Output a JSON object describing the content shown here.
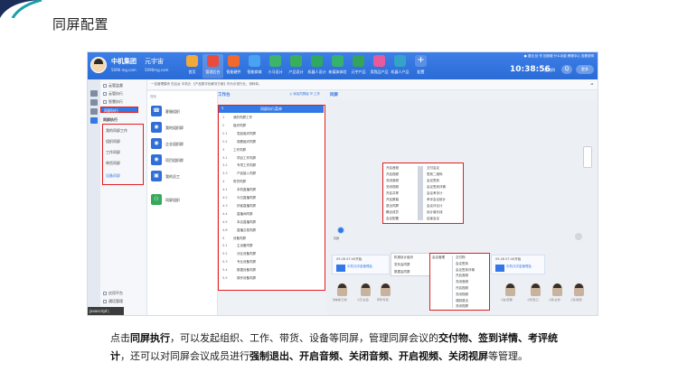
{
  "slide": {
    "title": "同屏配置"
  },
  "colors": {
    "corner_teal": "#1a9ea8",
    "corner_navy": "#1b2e5a",
    "topbar": "#2a6bd6",
    "accent": "#3478e5",
    "highlight_red": "#e02020"
  },
  "app": {
    "org_name": "中机集团",
    "org_sub": "5096 mg.com",
    "mode_name": "元宇宙",
    "mode_sub": "5096mg.com",
    "apps": [
      {
        "label": "首页",
        "color": "#f2a93b",
        "icon": "home-icon"
      },
      {
        "label": "管理后台",
        "color": "#e94b3c",
        "icon": "admin-icon"
      },
      {
        "label": "智能硬件",
        "color": "#f06a2e",
        "icon": "hardware-icon"
      },
      {
        "label": "智能商城",
        "color": "#4aa3f0",
        "icon": "shop-icon"
      },
      {
        "label": "小马设计",
        "color": "#3db36b",
        "icon": "design-icon"
      },
      {
        "label": "产品设计",
        "color": "#3aaf5b",
        "icon": "product-icon"
      },
      {
        "label": "机器人设计",
        "color": "#2fa862",
        "icon": "robot-icon"
      },
      {
        "label": "新媒体体验",
        "color": "#35b26f",
        "icon": "media-icon"
      },
      {
        "label": "元宇产品",
        "color": "#34a35b",
        "icon": "meta-icon"
      },
      {
        "label": "用我品产品",
        "color": "#e85a9b",
        "icon": "brand-icon"
      },
      {
        "label": "机器人产品",
        "color": "#33a3c8",
        "icon": "robot-product-icon"
      },
      {
        "label": "配置",
        "color": "#5a8fe8",
        "icon": "plus-icon"
      }
    ],
    "top_links": "● 退出   处 作   回到服   什么功能   教程中心   查看说明",
    "clock": "10:38:56",
    "clock_date": "星期四",
    "more_label": "更多",
    "search_glyph": "Q"
  },
  "nav": {
    "items_top": [
      {
        "label": "云管监督"
      },
      {
        "label": "云管执行"
      },
      {
        "label": "智慧执行"
      },
      {
        "label": "同屏执行"
      }
    ],
    "section_label": "同屏执行",
    "sub_items": [
      {
        "label": "我的同屏工作"
      },
      {
        "label": "组织同屏"
      },
      {
        "label": "工作同屏"
      },
      {
        "label": "带货同屏"
      },
      {
        "label": "设备同屏"
      }
    ],
    "items_bottom": [
      {
        "label": "应用平台"
      },
      {
        "label": "通话管理"
      },
      {
        "label": "资源管理"
      }
    ]
  },
  "subbar": {
    "path": "一站管理模块 在后台 中机元 【产品数字化解决方案】作为引领行业，请转体。",
    "back": "◄"
  },
  "contacts": {
    "search": "搜索",
    "items": [
      {
        "name": "客服组织",
        "glyph": "☎"
      },
      {
        "name": "我的组织群",
        "glyph": "◉"
      },
      {
        "name": "企业组织群",
        "glyph": "◉"
      },
      {
        "name": "项目组织群",
        "glyph": "◉"
      },
      {
        "name": "我的员工",
        "glyph": "▣"
      },
      {
        "name": "同屏组织",
        "glyph": "⚇"
      }
    ]
  },
  "workspace": {
    "label": "工作台",
    "links": "◎ 添加同屏组   ☰ 工作",
    "screen_label": "同屏"
  },
  "tree": {
    "header": "同屏执行菜单",
    "rows": [
      {
        "no": "1",
        "label": "我的同屏工作"
      },
      {
        "no": "2",
        "label": "组织同屏"
      },
      {
        "no": "2.1",
        "label": "发起组织同屏"
      },
      {
        "no": "2.2",
        "label": "观看组织同屏"
      },
      {
        "no": "3",
        "label": "工作同屏"
      },
      {
        "no": "3.1",
        "label": "项目工作同屏"
      },
      {
        "no": "3.2",
        "label": "专项工作同屏"
      },
      {
        "no": "3.3",
        "label": "产品接入同屏"
      },
      {
        "no": "4",
        "label": "带货同屏"
      },
      {
        "no": "4.1",
        "label": "本机直播同屏"
      },
      {
        "no": "4.2",
        "label": "今日直播同屏"
      },
      {
        "no": "4.3",
        "label": "好客直播同屏"
      },
      {
        "no": "4.4",
        "label": "直播间同屏"
      },
      {
        "no": "4.5",
        "label": "本店直播同屏"
      },
      {
        "no": "4.6",
        "label": "直播交易同屏"
      },
      {
        "no": "5",
        "label": "设备同屏"
      },
      {
        "no": "5.1",
        "label": "主设备同屏"
      },
      {
        "no": "5.2",
        "label": "分区设备同屏"
      },
      {
        "no": "5.3",
        "label": "专业设备同屏"
      },
      {
        "no": "5.4",
        "label": "数据设备同屏"
      },
      {
        "no": "5.5",
        "label": "操作设备同屏"
      }
    ]
  },
  "menu_a": {
    "left": [
      "开启音频",
      "开启视频",
      "关闭音频",
      "关闭视频",
      "开启共享",
      "开启屏幕",
      "退出同屏",
      "踢出成员",
      "会议配置"
    ],
    "right": [
      "交付会议",
      "签到二维码",
      "会议签到",
      "会议签到详情",
      "会议考评计",
      "考评会议统计",
      "会议评论计",
      "设计增长线",
      "结束会议"
    ]
  },
  "menu_b": {
    "items": [
      "交付物",
      "会议签到",
      "会议签到详情",
      "开启音频",
      "关闭音频",
      "开启视频",
      "关闭视频",
      "强制退出",
      "关闭视屏"
    ],
    "header": "会议管理"
  },
  "menu_c": {
    "items": [
      "机械设计组织",
      "发布会同屏",
      "数据会同屏"
    ]
  },
  "stage": {
    "dot_label": "同屏"
  },
  "cards": [
    {
      "time": "09.28 07:40开始",
      "name": "中机元宇宙管理会"
    },
    {
      "time": "09.28 07:40开始",
      "name": "中机元宇宙管理会"
    }
  ],
  "faces": [
    {
      "label": "张威威(王者)"
    },
    {
      "label": "小王(主任)"
    },
    {
      "label": "老李(专员)"
    },
    {
      "label": "小赵(经理)"
    },
    {
      "label": "小周(员工)"
    },
    {
      "label": "小陈(主管)"
    },
    {
      "label": "小吴(职员)"
    }
  ],
  "statusbar": "javascript:;",
  "caption": {
    "p1": "点击",
    "b1": "同屏执行",
    "p2": "，可以发起组织、工作、带货、设备等同屏，管理同屏会议的",
    "b2": "交付物、签到详情、考评统计",
    "p3": "，还可以对同屏会议成员进行",
    "b3": "强制退出、开启音频、关闭音频、开启视频、关闭视屏",
    "p4": "等管理。"
  }
}
